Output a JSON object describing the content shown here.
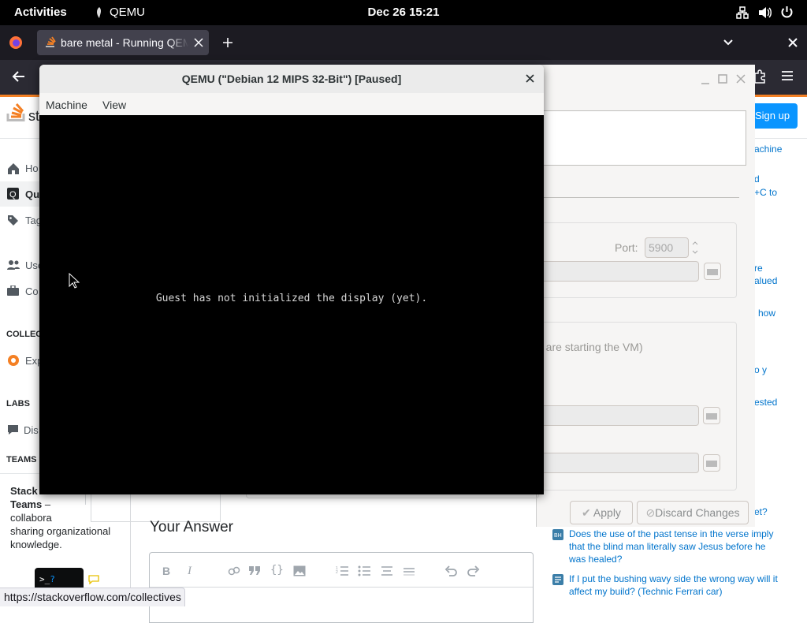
{
  "topbar": {
    "activities": "Activities",
    "app_name": "QEMU",
    "clock": "Dec 26  15:21"
  },
  "browser": {
    "tab_title": "bare metal - Running QEMU",
    "status_url": "https://stackoverflow.com/collectives"
  },
  "so": {
    "nav_home": "Ho",
    "nav_questions": "Qu",
    "nav_tags": "Tag",
    "nav_users": "Use",
    "nav_companies": "Co",
    "collectives_heading": "COLLEC",
    "nav_explore": "Exp",
    "labs_heading": "LABS",
    "nav_discussions": "Dis",
    "teams_heading": "TEAMS",
    "teams_title": "Stack",
    "teams_title2": "Teams",
    "teams_desc1": "collabora",
    "teams_desc2": "sharing organizational",
    "teams_desc3": "knowledge.",
    "sign_up": "Sign up",
    "your_answer": "Your Answer",
    "side_text_1": "achine",
    "side_text_2": "d",
    "side_text_3": "+C to",
    "side_text_4": "re",
    "side_text_5": "alued",
    "side_text_6": "how",
    "side_text_7": "o y",
    "side_text_8": "ested",
    "side_text_9": "et?",
    "hnq_1": "Does the use of the past tense in the verse imply that the blind man literally saw Jesus before he was healed?",
    "hnq_2": "If I put the bushing wavy side the wrong way will it affect my build? (Technic Ferrari car)"
  },
  "vmm": {
    "port_label": "Port:",
    "port_value": "5900",
    "starting_text": "u are starting the VM)",
    "apply_label": "Apply",
    "discard_label": "Discard Changes"
  },
  "qemu": {
    "title": "QEMU (\"Debian 12 MIPS 32-Bit\") [Paused]",
    "menu_machine": "Machine",
    "menu_view": "View",
    "message": "Guest has not initialized the display (yet)."
  },
  "colors": {
    "so_orange": "#f48024",
    "so_blue": "#0a95ff",
    "link_blue": "#0074cc"
  }
}
